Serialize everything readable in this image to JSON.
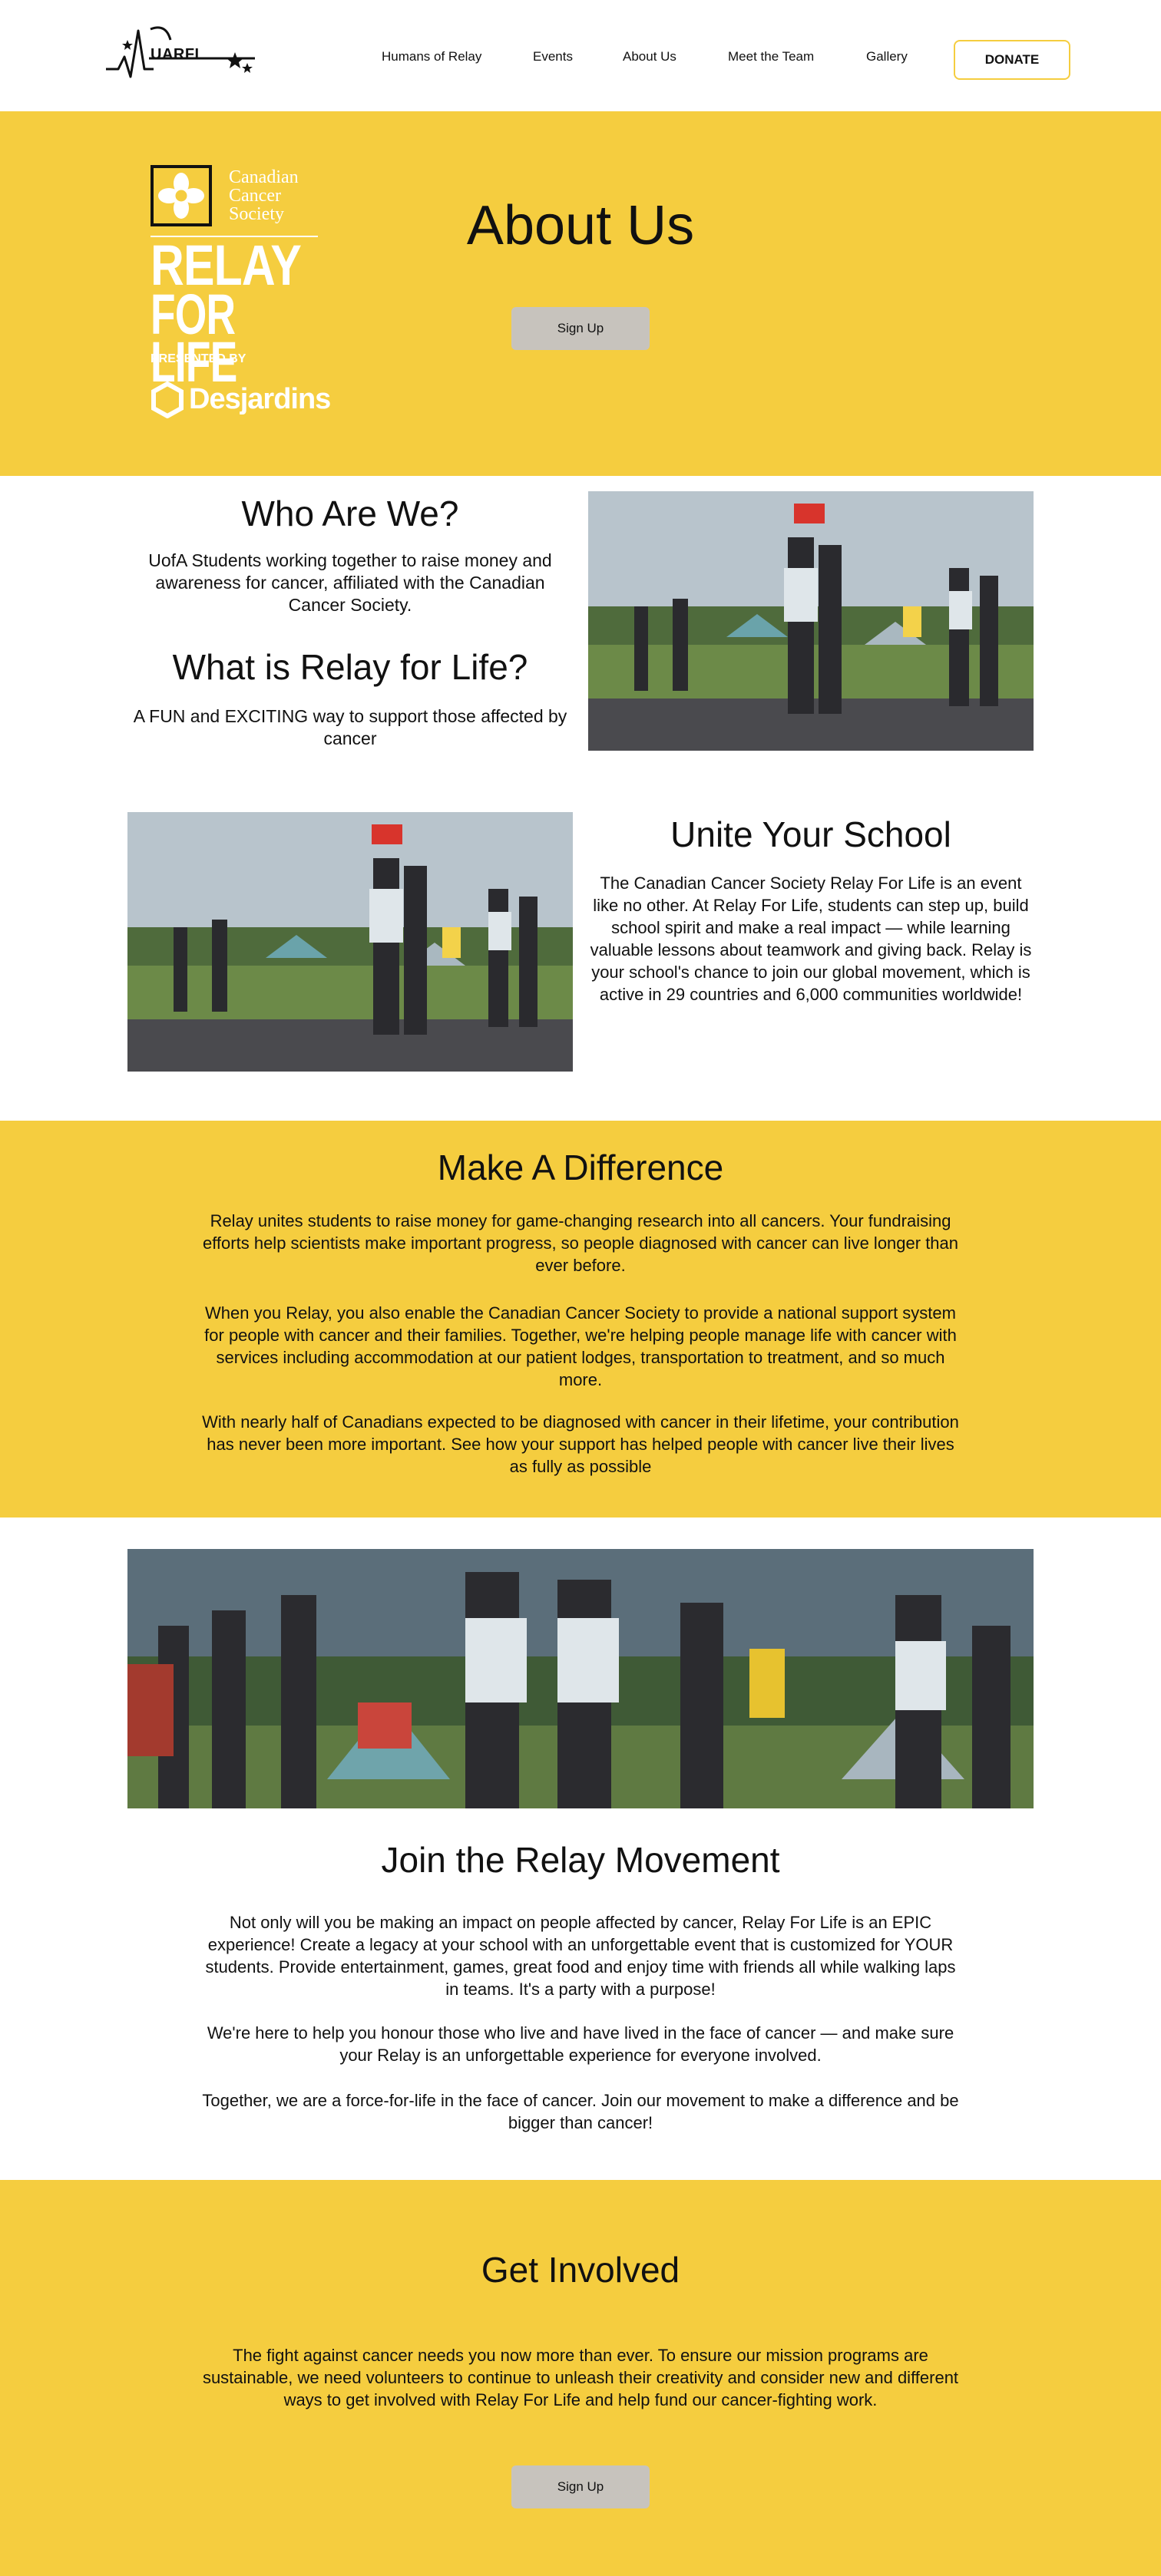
{
  "header": {
    "logo_text": "UARFL",
    "nav": [
      "Humans of Relay",
      "Events",
      "About Us",
      "Meet the Team",
      "Gallery"
    ],
    "donate_label": "DONATE"
  },
  "hero": {
    "logo": {
      "org_line1": "Canadian",
      "org_line2": "Cancer",
      "org_line3": "Society",
      "relay_line1": "RELAY",
      "relay_line2": "FOR LIFE",
      "presented_by": "PRESENTED BY",
      "sponsor": "Desjardins"
    },
    "title": "About Us",
    "signup_label": "Sign Up"
  },
  "who": {
    "title": "Who Are We?",
    "text": "UofA Students working together to raise money and awareness for cancer, affiliated with the Canadian Cancer Society.",
    "title2": "What is Relay for Life?",
    "text2": "A FUN and EXCITING way to support those affected by cancer"
  },
  "unite": {
    "title": "Unite Your School",
    "text": "The Canadian Cancer Society Relay For Life is an event like no other. At Relay For Life, students can step up, build school spirit and make a real impact — while learning valuable lessons about teamwork and giving back. Relay is your school's chance to join our global movement, which is active in 29 countries and 6,000 communities worldwide!"
  },
  "difference": {
    "title": "Make A Difference",
    "p1": "Relay unites students to raise money for game-changing research into all cancers. Your fundraising efforts help scientists make important progress, so people diagnosed with cancer can live longer than ever before.",
    "p2": "When you Relay, you also enable the Canadian Cancer Society to provide a national support system for people with cancer and their families. Together, we're helping people manage life with cancer with services including accommodation at our patient lodges, transportation to treatment, and so much more.",
    "p3": "With nearly half of Canadians expected to be diagnosed with cancer in their lifetime, your contribution has never been more important. See how your support has helped people with cancer live their lives as fully as possible"
  },
  "join": {
    "title": "Join the Relay Movement",
    "p1": "Not only will you be making an impact on people affected by cancer, Relay For Life is an EPIC experience! Create a legacy at your school with an unforgettable event that is customized for YOUR students. Provide entertainment, games, great food and enjoy time with friends all while walking laps in teams. It's a party with a purpose!",
    "p2": "We're here to help you honour those who live and have lived in the face of cancer — and make sure your Relay is an unforgettable experience for everyone involved.",
    "p3": "Together, we are a force-for-life in the face of cancer. Join our movement to make a difference and be bigger than cancer!"
  },
  "involved": {
    "title": "Get Involved",
    "text": "The fight against cancer needs you now more than ever. To ensure our mission programs are sustainable, we need volunteers to continue to unleash their creativity and consider new and different ways to get involved with Relay For Life and help fund our cancer-fighting work.",
    "signup_label": "Sign Up"
  },
  "colors": {
    "accent_yellow": "#f5cd3f",
    "button_grey": "#c7c3bd",
    "text": "#111111"
  },
  "icons": [
    "uarfl-logo-icon",
    "daffodil-icon",
    "desjardins-hexagon-icon"
  ]
}
